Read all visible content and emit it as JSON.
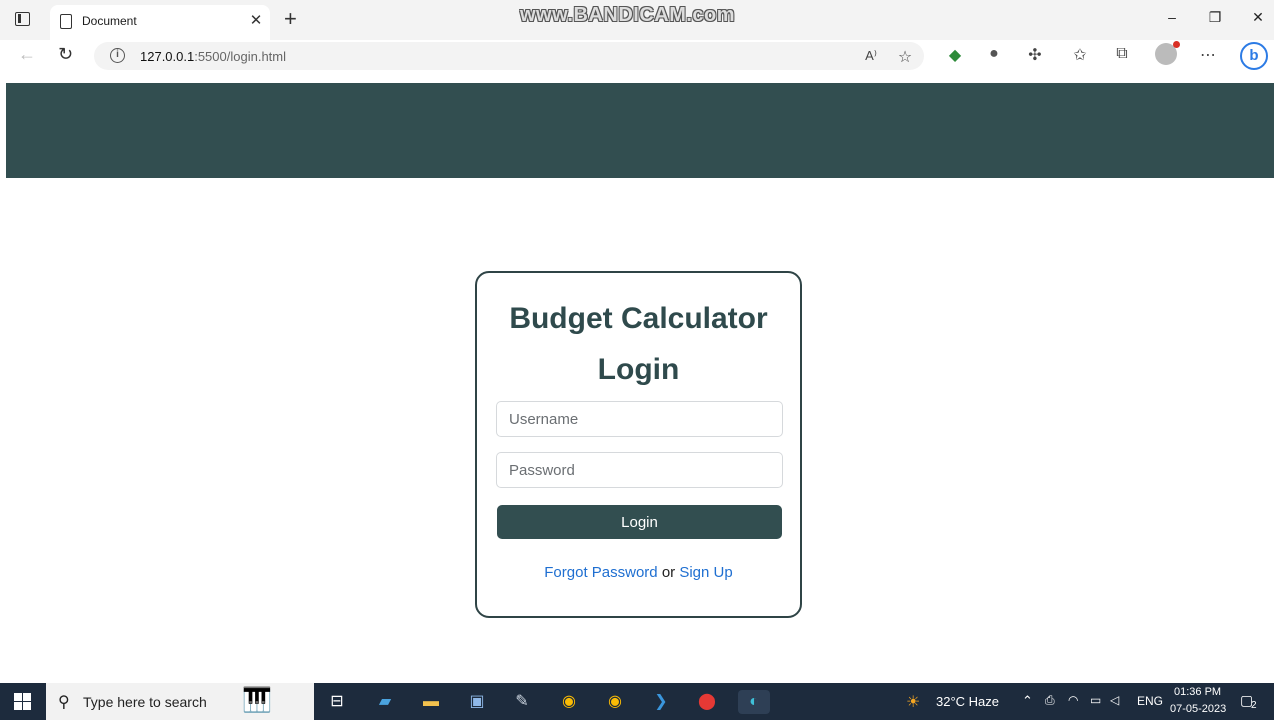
{
  "browser": {
    "tab_title": "Document",
    "tab_close": "✕",
    "new_tab": "+",
    "watermark": "www.BANDICAM.com",
    "url_host": "127.0.0.1",
    "url_rest": ":5500/login.html",
    "window_minimize": "–",
    "window_restore": "❐",
    "window_close": "✕"
  },
  "login": {
    "title_line1": "Budget Calculator",
    "title_line2": "Login",
    "username_placeholder": "Username",
    "password_placeholder": "Password",
    "login_label": "Login",
    "forgot_label": "Forgot Password",
    "or_text": " or ",
    "signup_label": "Sign Up"
  },
  "taskbar": {
    "search_placeholder": "Type here to search",
    "weather": "32°C  Haze",
    "language": "ENG",
    "time": "01:36 PM",
    "date": "07-05-2023",
    "notifications": "2"
  },
  "colors": {
    "navbar": "#324e50",
    "primary_button": "#324e50",
    "link": "#1f6fd1",
    "taskbar": "#1d2b3d"
  }
}
